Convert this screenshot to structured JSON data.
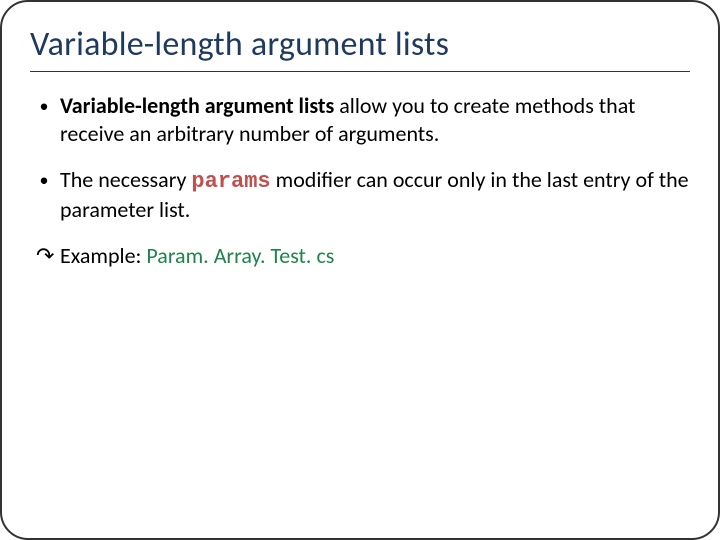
{
  "title": "Variable-length argument lists",
  "bullets": [
    {
      "bold": "Variable-length argument lists",
      "rest": " allow you to create methods that receive an arbitrary number of arguments."
    },
    {
      "pre": "The necessary ",
      "code": "params",
      "post": " modifier can occur only in the last entry of the parameter list."
    }
  ],
  "example": {
    "label": "Example: ",
    "filename": "Param. Array. Test. cs"
  }
}
